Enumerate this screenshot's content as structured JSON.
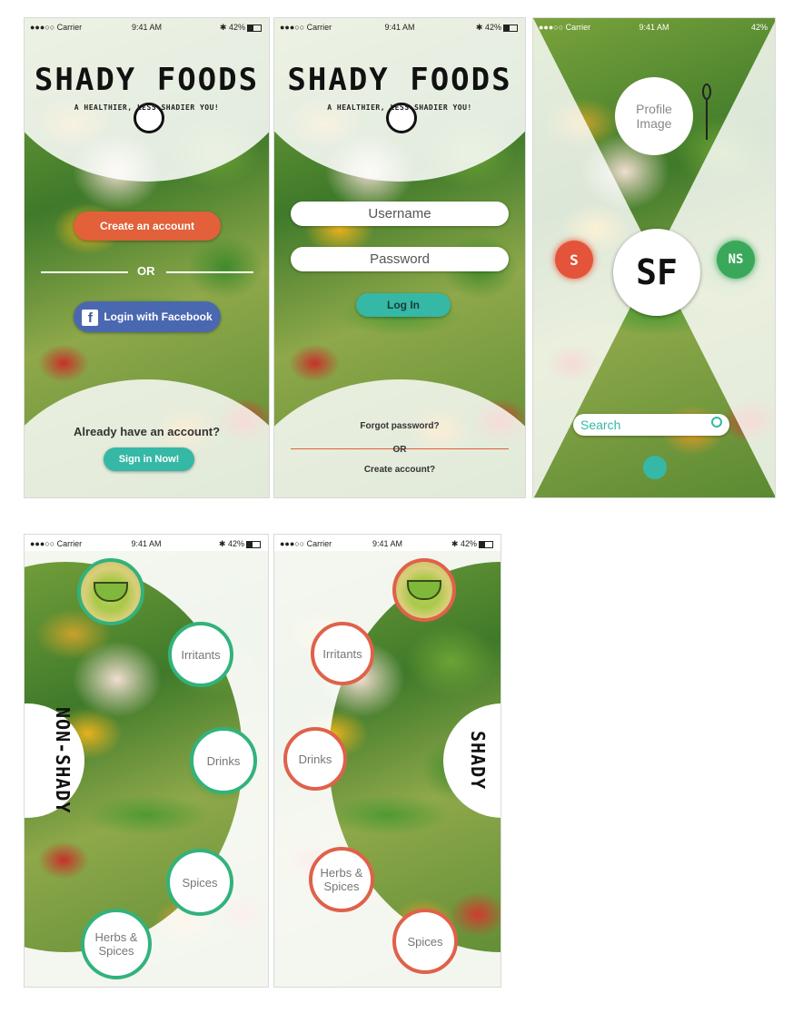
{
  "status": {
    "carrier": "●●●○○ Carrier",
    "time": "9:41 AM",
    "battery": "42%",
    "bt": "✱"
  },
  "brand": {
    "logo": "SHADY FOODS",
    "tagline": "A HEALTHIER, LESS SHADIER YOU!",
    "monogram": "SF"
  },
  "screen1": {
    "create_account": "Create an account",
    "or": "OR",
    "facebook_login": "Login with Facebook",
    "already": "Already have an account?",
    "sign_in": "Sign in Now!"
  },
  "screen2": {
    "username_placeholder": "Username",
    "password_placeholder": "Password",
    "login": "Log In",
    "forgot": "Forgot password?",
    "or": "OR",
    "create": "Create account?"
  },
  "screen3": {
    "profile_image": "Profile Image",
    "shady_badge": "S",
    "nonshady_badge": "NS",
    "search_placeholder": "Search"
  },
  "screen4": {
    "side_label": "NON-SHADY",
    "items": [
      "Irritants",
      "Drinks",
      "Spices",
      "Herbs & Spices"
    ]
  },
  "screen5": {
    "side_label": "SHADY",
    "items": [
      "Irritants",
      "Drinks",
      "Herbs & Spices",
      "Spices"
    ]
  },
  "colors": {
    "orange": "#e2603a",
    "facebook": "#3b5998",
    "teal": "#35b8a6",
    "green_ring": "#32b27c",
    "red_ring": "#e0614a"
  }
}
